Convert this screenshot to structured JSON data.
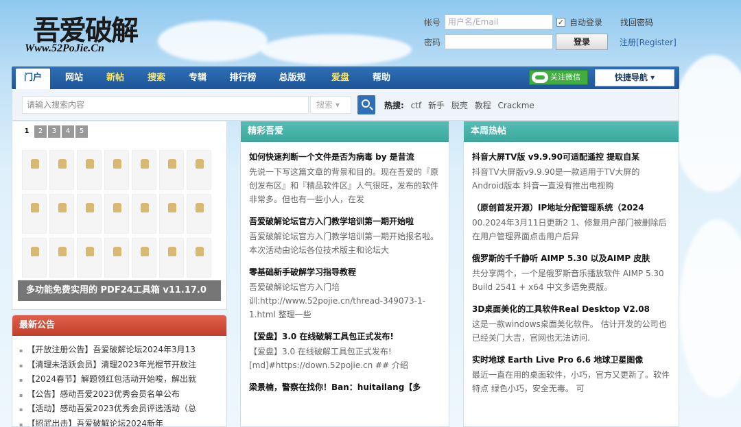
{
  "logo": {
    "title": "吾爱破解",
    "url_text": "Www.52PoJie.Cn"
  },
  "login": {
    "account_label": "帐号",
    "account_placeholder": "用户名/Email",
    "password_label": "密码",
    "auto_login_label": "自动登录",
    "auto_login_checked": true,
    "forgot_label": "找回密码",
    "login_button": "登录",
    "register_label": "注册[Register]"
  },
  "nav": {
    "items": [
      {
        "label": "门户",
        "active": true
      },
      {
        "label": "网站"
      },
      {
        "label": "新帖",
        "highlight": true
      },
      {
        "label": "搜索",
        "highlight": true
      },
      {
        "label": "专辑"
      },
      {
        "label": "排行榜"
      },
      {
        "label": "总版规"
      },
      {
        "label": "爱盘",
        "highlight": true
      },
      {
        "label": "帮助"
      }
    ],
    "wechat_label": "关注微信",
    "quick_nav_label": "快捷导航 ▾"
  },
  "search": {
    "placeholder": "请输入搜索内容",
    "type_label": "搜索 ▾",
    "hot_label": "热搜:",
    "hot_terms": [
      "ctf",
      "新手",
      "脱壳",
      "教程",
      "Crackme"
    ]
  },
  "slider": {
    "pages": [
      "1",
      "2",
      "3",
      "4",
      "5"
    ],
    "current_page": 1,
    "caption": "多功能免费实用的 PDF24工具箱 v11.17.0"
  },
  "notice": {
    "title": "最新公告",
    "items": [
      "【开放注册公告】吾爱破解论坛2024年3月13",
      "【清理未活跃会员】清理2023年光棍节开放注",
      "【2024春节】解题领红包活动开始唆，解出就",
      "【公告】感动吾爱2023优秀会员名单公布",
      "【活动】感动吾爱2023优秀会员评选活动（总",
      "【招武出击】吾爱破解论坛2024新年"
    ]
  },
  "featured": {
    "title": "精彩吾爱",
    "articles": [
      {
        "title": "如何快速判断一个文件是否为病毒 by 是昔流",
        "summary": "先说一下写这篇文章的背景和目的。现在吾爱的『原创发布区』和『精品软件区』人气很旺，发布的软件非常多。但也有一些小人，在发"
      },
      {
        "title": "吾爱破解论坛官方入门教学培训第一期开始啦",
        "summary": "吾爱破解论坛官方入门教学培训第一期开始报名啦。本次活动由论坛各位技术版主和论坛大"
      },
      {
        "title": "零基础新手破解学习指导教程",
        "summary": "吾爱破解论坛官方入门培训:http://www.52pojie.cn/thread-349073-1-1.html 整理一些"
      },
      {
        "title": "【爱盘】3.0 在线破解工具包正式发布!",
        "summary": "【爱盘】3.0 在线破解工具包正式发布![md]#https://down.52pojie.cn ## 介绍"
      },
      {
        "title": "梁景楠，警察在找你！Ban：huitailang【多",
        "summary": ""
      }
    ]
  },
  "weekly": {
    "title": "本周热帖",
    "articles": [
      {
        "title": "抖音大屏TV版 v9.9.90可适配遥控 提取自某",
        "summary": "抖音TV大屏版v9.9.90是一款适用于TV大屏的Android版本 抖音一直没有推出电视购"
      },
      {
        "title": "（原创首发开源）IP地址分配管理系统（2024",
        "summary": "00.2024年3月11日更新2 1、修复用户部门被删除后在用户管理界面点击用户后异"
      },
      {
        "title": "俄罗斯的千千静听 AIMP 5.30 以及AIMP 皮肤",
        "summary": "共分享两个，一个是俄罗斯音乐播放软件 AIMP 5.30 Build 2541 + x64 中文多语免费版。"
      },
      {
        "title": "3D桌面美化的工具软件Real Desktop V2.08",
        "summary": "这是一款windows桌面美化软件。 估计开发的公司也已经关门大吉，官网也无法访问."
      },
      {
        "title": "实时地球 Earth Live Pro 6.6 地球卫星图像",
        "summary": "最近一直在用的桌面软件，小巧，官方又更新了。软件特点 绿色小巧，安全无毒。 可"
      }
    ]
  }
}
